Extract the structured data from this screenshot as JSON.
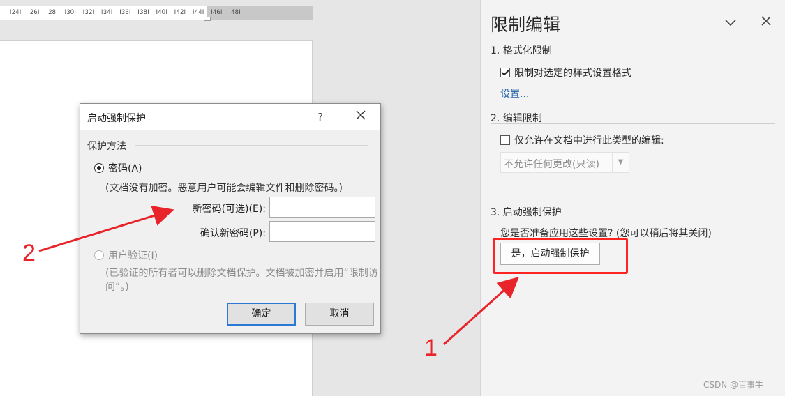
{
  "ruler": {
    "ticks": [
      "24",
      "26",
      "28",
      "30",
      "32",
      "34",
      "36",
      "38",
      "40",
      "42",
      "44",
      "46",
      "48"
    ]
  },
  "pane": {
    "title": "限制编辑",
    "section1": {
      "heading": "1. 格式化限制",
      "checkbox_label": "限制对选定的样式设置格式",
      "checked": true,
      "link": "设置..."
    },
    "section2": {
      "heading": "2. 编辑限制",
      "checkbox_label": "仅允许在文档中进行此类型的编辑:",
      "checked": false,
      "dropdown_value": "不允许任何更改(只读)"
    },
    "section3": {
      "heading": "3. 启动强制保护",
      "question": "您是否准备应用这些设置? (您可以稍后将其关闭)",
      "button": "是，启动强制保护"
    }
  },
  "dialog": {
    "title": "启动强制保护",
    "help": "?",
    "group_label": "保护方法",
    "password_option": "密码(A)",
    "password_note": "(文档没有加密。恶意用户可能会编辑文件和删除密码。)",
    "new_password_label": "新密码(可选)(E):",
    "new_password_value": "",
    "confirm_password_label": "确认新密码(P):",
    "confirm_password_value": "",
    "user_auth_option": "用户验证(I)",
    "user_auth_note": "(已验证的所有者可以删除文档保护。文档被加密并启用“限制访问”。)",
    "ok_button": "确定",
    "cancel_button": "取消"
  },
  "annotations": {
    "label_1": "1",
    "label_2": "2",
    "color": "#e8232a"
  },
  "watermark": "CSDN @百事牛"
}
